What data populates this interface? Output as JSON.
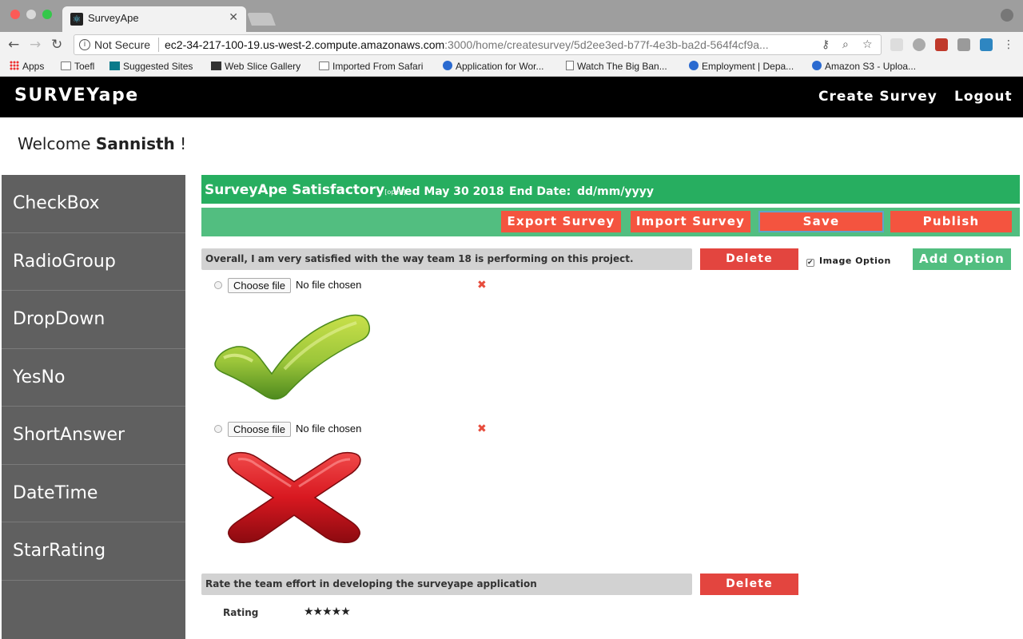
{
  "browser": {
    "tab_title": "SurveyApe",
    "tab_close": "✕",
    "security_label": "Not Secure",
    "url_host": "ec2-34-217-100-19.us-west-2.compute.amazonaws.com",
    "url_path": ":3000/home/createsurvey/5d2ee3ed-b77f-4e3b-ba2d-564f4cf9a...",
    "bookmarks": [
      {
        "label": "Apps",
        "icon": "apps-grid-icon"
      },
      {
        "label": "Toefl",
        "icon": "folder-icon"
      },
      {
        "label": "Suggested Sites",
        "icon": "bing-icon"
      },
      {
        "label": "Web Slice Gallery",
        "icon": "web-slice-icon"
      },
      {
        "label": "Imported From Safari",
        "icon": "folder-icon"
      },
      {
        "label": "Application for Wor...",
        "icon": "globe-icon"
      },
      {
        "label": "Watch The Big Ban...",
        "icon": "page-icon"
      },
      {
        "label": "Employment | Depa...",
        "icon": "globe-icon"
      },
      {
        "label": "Amazon S3 - Uploa...",
        "icon": "globe-icon"
      }
    ]
  },
  "app": {
    "brand": "SURVEYape",
    "nav": {
      "create_survey": "Create Survey",
      "logout": "Logout"
    },
    "welcome_prefix": "Welcome ",
    "user_name": "Sannisth",
    "welcome_suffix": " !"
  },
  "sidebar": {
    "items": [
      {
        "label": "CheckBox"
      },
      {
        "label": "RadioGroup"
      },
      {
        "label": "DropDown"
      },
      {
        "label": "YesNo"
      },
      {
        "label": "ShortAnswer"
      },
      {
        "label": "DateTime"
      },
      {
        "label": "StarRating"
      }
    ]
  },
  "survey": {
    "title": "SurveyApe Satisfactory",
    "status": "[open]",
    "date": "Wed May 30 2018",
    "end_date_label": "End Date:",
    "end_date_value": "dd/mm/yyyy",
    "actions": {
      "export": "Export Survey",
      "import": "Import Survey",
      "save": "Save",
      "publish": "Publish"
    },
    "questions": [
      {
        "text": "Overall, I am very satisfied with the way team 18 is performing on this project.",
        "delete_label": "Delete",
        "image_option_label": "Image Option",
        "image_option_checked": true,
        "add_option_label": "Add Option",
        "options": [
          {
            "file_button": "Choose file",
            "file_status": "No file chosen",
            "image": "green-checkmark"
          },
          {
            "file_button": "Choose file",
            "file_status": "No file chosen",
            "image": "red-x"
          }
        ]
      },
      {
        "text": "Rate the team effort in developing the surveyape application",
        "delete_label": "Delete",
        "rating_label": "Rating",
        "stars": "★★★★★"
      }
    ]
  },
  "colors": {
    "header_bg": "#000000",
    "sidebar_bg": "#606060",
    "survey_bar": "#27ae60",
    "action_bar": "#52be80",
    "action_button": "#f4543f",
    "delete_button": "#e3453f"
  }
}
